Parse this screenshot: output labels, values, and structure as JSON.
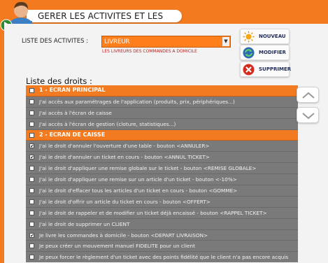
{
  "window": {
    "title": "GERER LES ACTIVITES ET LES"
  },
  "activities": {
    "label": "LISTE DES ACTIVITES :",
    "selected": "LIVREUR",
    "description": "LES LIVREURS DES COMMANDES A DOMICILE"
  },
  "buttons": {
    "new": "NOUVEAU",
    "edit": "MODIFIER",
    "delete": "SUPPRIMER"
  },
  "rights": {
    "title": "Liste des droits :",
    "rows": [
      {
        "type": "section",
        "label": "1 - ECRAN PRINCIPAL",
        "checked": false
      },
      {
        "type": "item",
        "label": "J'ai accès aux paramétrages de l'application (produits, prix, périphériques...)",
        "checked": false
      },
      {
        "type": "item",
        "label": "J'ai accès à l'écran de caisse",
        "checked": false
      },
      {
        "type": "item",
        "label": "J'ai accès à l'écran de gestion (cloture, statistiques...)",
        "checked": false
      },
      {
        "type": "section",
        "label": "2 - ECRAN DE CAISSE",
        "checked": false
      },
      {
        "type": "item",
        "label": "J'ai le droit d'annuler l'ouverture d'une table - bouton <ANNULER>",
        "checked": true
      },
      {
        "type": "item",
        "label": "J'ai le droit d'annuler un ticket en cours - bouton <ANNUL TICKET>",
        "checked": true
      },
      {
        "type": "item",
        "label": "J'ai le droit d'appliquer une remise globale sur le ticket - bouton <REMISE GLOBALE>",
        "checked": false
      },
      {
        "type": "item",
        "label": "J'ai le droit d'appliquer une remise sur un article d'un ticket - bouton <-10%>",
        "checked": false
      },
      {
        "type": "item",
        "label": "J'ai le droit d'effacer tous les articles d'un ticket en cours - bouton <GOMME>",
        "checked": false
      },
      {
        "type": "item",
        "label": "J'ai le droit d'offrir un article du ticket en cours - bouton <OFFERT>",
        "checked": false
      },
      {
        "type": "item",
        "label": "J'ai le droit de rappeler et de modifier un ticket déjà encaissé - bouton <RAPPEL TICKET>",
        "checked": false
      },
      {
        "type": "item",
        "label": "J'ai le droit de supprimer un CLIENT",
        "checked": false
      },
      {
        "type": "item",
        "label": "Je livre les commandes à domicile - bouton <DEPART LIVRAISON>",
        "checked": true
      },
      {
        "type": "item",
        "label": "Je peux créer un mouvement manuel FIDELITE pour un client",
        "checked": false
      },
      {
        "type": "item",
        "label": "Je peux forcer le règlement d'un ticket avec des points fidélité que le client n'a pas encore acquis",
        "checked": false
      }
    ]
  },
  "colors": {
    "accent": "#f47a1f",
    "list_bg": "#7a7a7a",
    "title_text": "#1f2b57",
    "description": "#c11b1b"
  },
  "icons": {
    "user": "user-icon",
    "new": "sun-icon",
    "edit": "refresh-icon",
    "delete": "close-icon"
  }
}
